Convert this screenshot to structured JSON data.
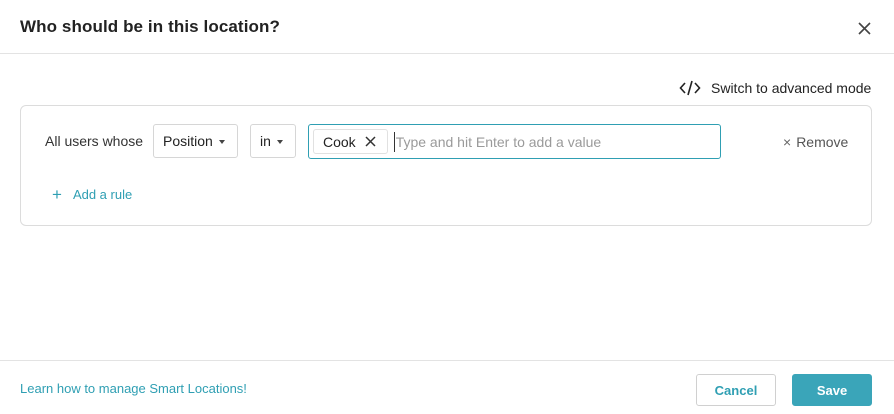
{
  "dialog": {
    "title": "Who should be in this location?",
    "close_icon": "close-icon"
  },
  "toolbar": {
    "switch_mode_icon": "code-icon",
    "switch_mode_label": "Switch to advanced mode"
  },
  "rules": [
    {
      "prefix": "All users whose",
      "field": "Position",
      "operator": "in",
      "values": [
        "Cook"
      ],
      "input_placeholder": "Type and hit Enter to add a value",
      "remove_label": "Remove"
    }
  ],
  "add_rule_label": "Add a rule",
  "footer": {
    "help_link": "Learn how to manage Smart Locations!",
    "cancel_label": "Cancel",
    "save_label": "Save"
  },
  "colors": {
    "accent": "#2f9fb3",
    "primary_button": "#3aa5b9"
  }
}
